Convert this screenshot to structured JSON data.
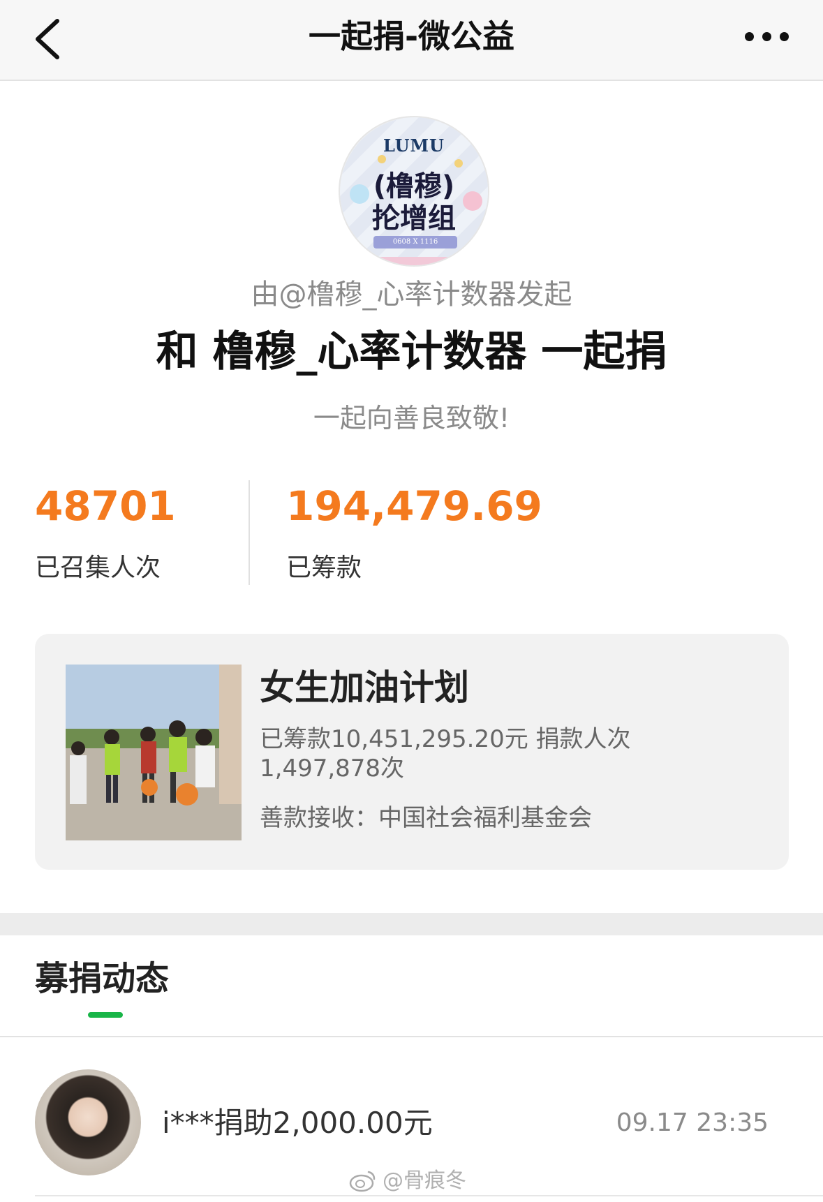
{
  "navbar": {
    "back_icon": "chevron-left-icon",
    "title": "一起捐-微公益",
    "more_icon": "more-horizontal-icon"
  },
  "header": {
    "avatar": {
      "top_text": "LUMU",
      "line1": "(橹穆)",
      "line2": "抡增组",
      "banner": "0608 X 1116"
    },
    "initiator": "由@橹穆_心率计数器发起",
    "headline": "和 橹穆_心率计数器 一起捐",
    "slogan": "一起向善良致敬!"
  },
  "stats": {
    "count_value": "48701",
    "count_label": "已召集人次",
    "amount_value": "194,479.69",
    "amount_label": "已筹款",
    "accent_color": "#f47a1e"
  },
  "project": {
    "title": "女生加油计划",
    "stats_text": "已筹款10,451,295.20元  捐款人次1,497,878次",
    "receiver": "善款接收：中国社会福利基金会"
  },
  "tabs": {
    "active_label": "募捐动态",
    "indicator_color": "#19b548"
  },
  "feed": [
    {
      "text": "i***捐助2,000.00元",
      "time": "09.17 23:35"
    }
  ],
  "watermark": {
    "icon": "weibo-icon",
    "text": "@骨痕冬"
  }
}
